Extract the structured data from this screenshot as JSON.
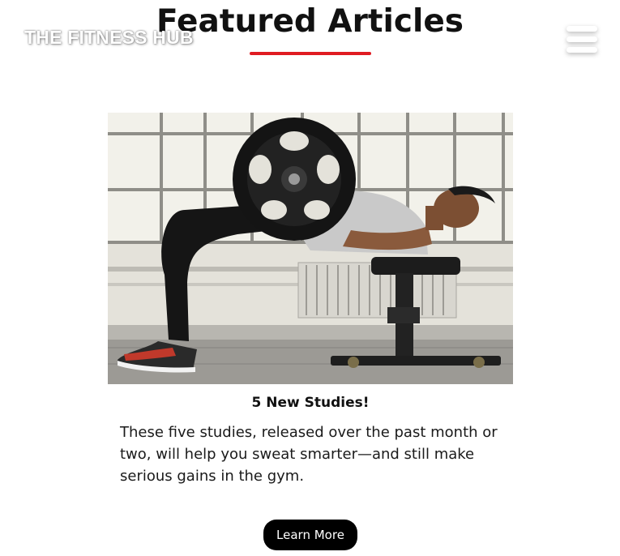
{
  "header": {
    "brand": "THE FITNESS HUB",
    "menu_icon": "hamburger-menu-icon"
  },
  "section": {
    "title": "Featured Articles",
    "accent_color": "#e01b22"
  },
  "article": {
    "image_alt": "Man performing barbell hip thrust on bench in gym",
    "title": "5 New Studies!",
    "body": "These five studies, released over the past month or two, will help you sweat smarter—and still make serious gains in the gym.",
    "cta_label": "Learn More"
  }
}
